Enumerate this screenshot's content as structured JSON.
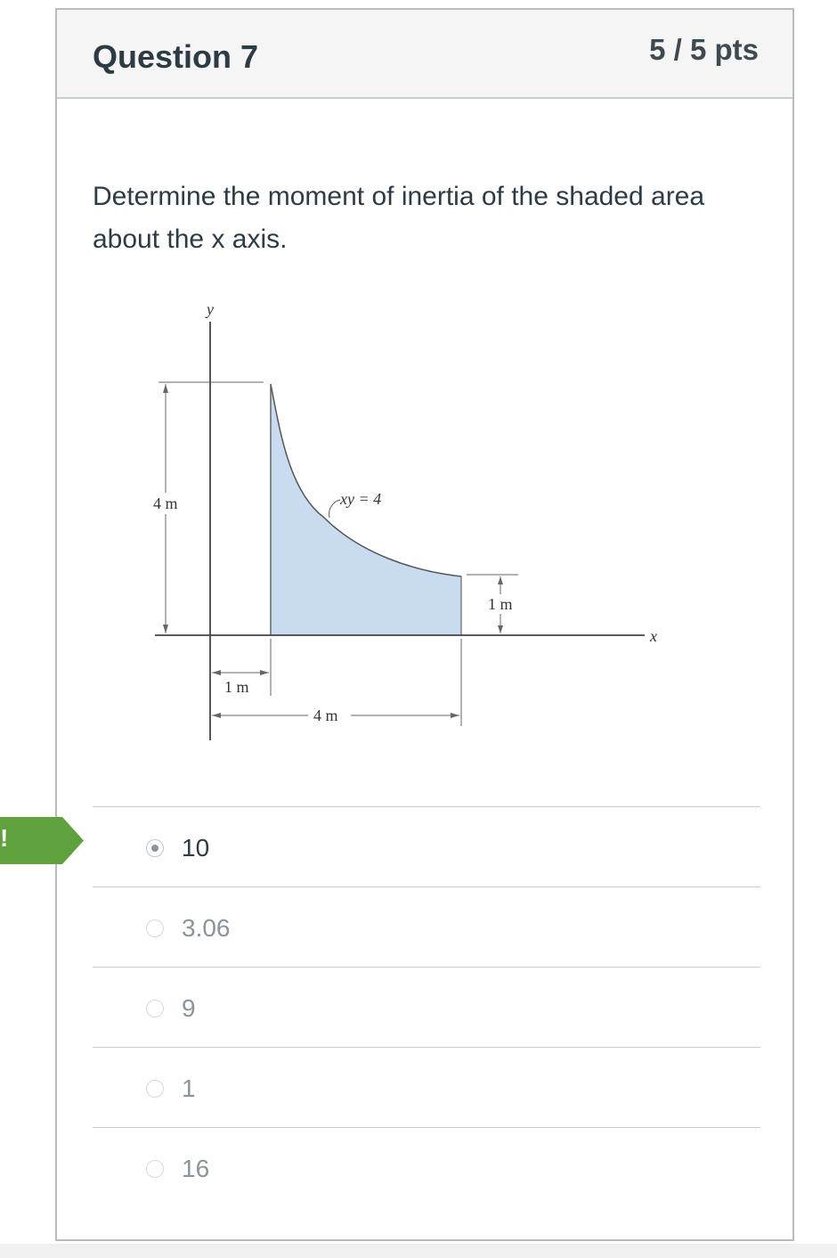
{
  "question": {
    "title": "Question 7",
    "points": "5 / 5 pts",
    "text": "Determine the moment of inertia of the shaded area about the x axis."
  },
  "figure": {
    "axis_y_label": "y",
    "axis_x_label": "x",
    "height_dim": "4 m",
    "curve_label": "xy = 4",
    "right_height_dim": "1 m",
    "left_offset_dim": "1 m",
    "width_dim": "4 m",
    "fill_color": "#c9dcef"
  },
  "answers": [
    {
      "label": "10",
      "selected": true
    },
    {
      "label": "3.06",
      "selected": false
    },
    {
      "label": "9",
      "selected": false
    },
    {
      "label": "1",
      "selected": false
    },
    {
      "label": "16",
      "selected": false
    }
  ],
  "correct_flag": {
    "text": "!",
    "color": "#5fa23d"
  }
}
